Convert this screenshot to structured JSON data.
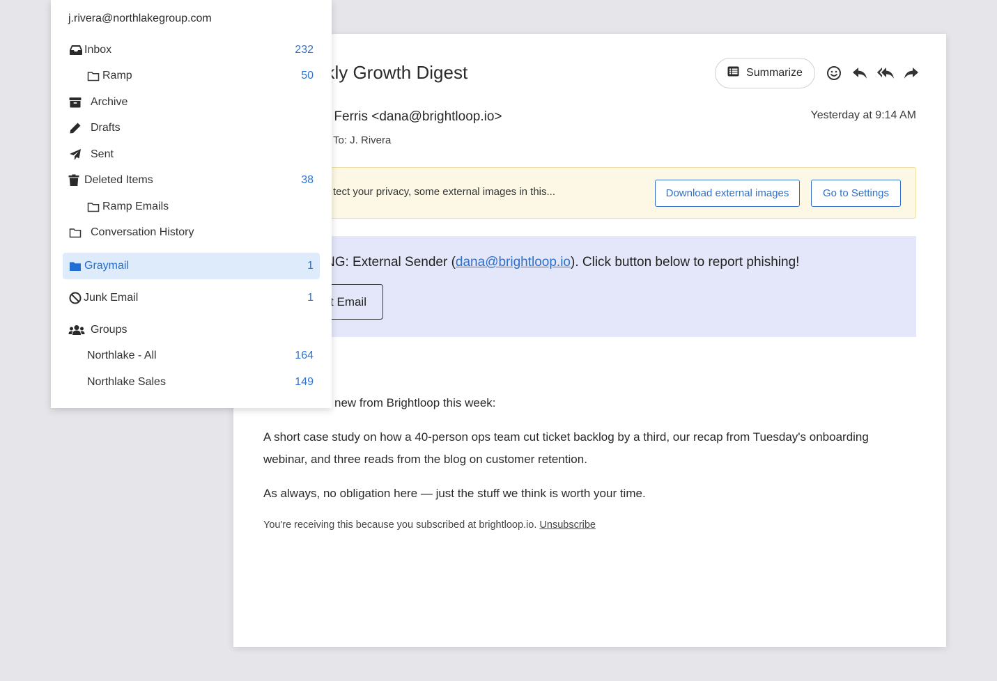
{
  "account": "j.rivera@northlakegroup.com",
  "folders": [
    {
      "label": "Inbox",
      "count": "232",
      "icon": "inbox-icon"
    },
    {
      "label": "Ramp",
      "count": "50",
      "icon": "folder-outline-icon"
    },
    {
      "label": "Archive",
      "count": "",
      "icon": "archive-icon"
    },
    {
      "label": "Drafts",
      "count": "",
      "icon": "pencil-icon"
    },
    {
      "label": "Sent",
      "count": "",
      "icon": "paper-plane-icon"
    },
    {
      "label": "Deleted Items",
      "count": "38",
      "icon": "trash-icon"
    },
    {
      "label": "Ramp Emails",
      "count": "",
      "icon": "folder-outline-icon"
    },
    {
      "label": "Conversation History",
      "count": "",
      "icon": "folder-outline-icon"
    },
    {
      "label": "Graymail",
      "count": "1",
      "icon": "folder-solid-icon",
      "selected": true
    },
    {
      "label": "Junk Email",
      "count": "1",
      "icon": "ban-icon"
    },
    {
      "label": "Groups",
      "count": "",
      "icon": "users-icon"
    },
    {
      "label": "Northlake - All",
      "count": "164",
      "icon": ""
    },
    {
      "label": "Northlake Sales",
      "count": "149",
      "icon": ""
    }
  ],
  "email": {
    "subject": "ekly Growth Digest",
    "summarize_label": "Summarize",
    "sender": "na Ferris <dana@brightloop.io>",
    "recipient": "To: J. Rivera",
    "received": "Yesterday at 9:14 AM",
    "privacy_text": "tect your privacy, some external images in this...",
    "download_images_label": "Download external images",
    "settings_label": "Go to Settings",
    "warning_prefix": "NG: External Sender (",
    "warning_email": "dana@brightloop.io",
    "warning_suffix": "). Click button below to report phishing!",
    "report_label": "t Email",
    "body_1": "new from Brightloop this week:",
    "body_2": "A short case study on how a 40-person ops team cut ticket backlog by a third, our recap from Tuesday's onboarding webinar, and three reads from the blog on customer retention.",
    "body_3": "As always, no obligation here — just the stuff we think is worth your time.",
    "footer_text": "You're receiving this because you subscribed at brightloop.io.",
    "unsubscribe_label": "Unsubscribe"
  },
  "colors": {
    "accent": "#2f6fc6",
    "selected_bg": "#deebfb",
    "privacy_bg": "#fdf8e6",
    "warning_bg": "#e4e7f9"
  }
}
